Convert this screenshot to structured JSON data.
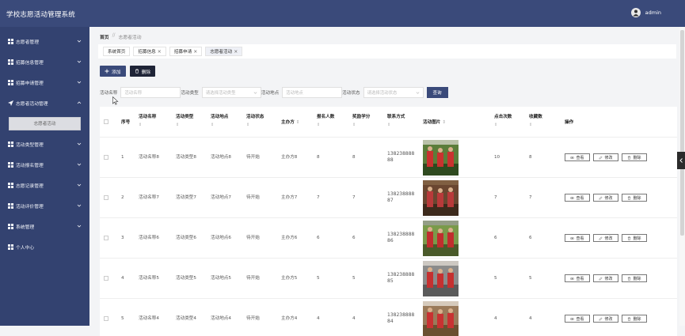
{
  "app": {
    "title": "学校志愿活动管理系统",
    "user": "admin"
  },
  "sidebar": {
    "items": [
      {
        "label": "志愿者管理"
      },
      {
        "label": "招募信息管理"
      },
      {
        "label": "招募申请管理"
      },
      {
        "label": "志愿者活动管理",
        "expanded": true
      },
      {
        "label": "活动类型管理"
      },
      {
        "label": "活动报名管理"
      },
      {
        "label": "志愿记录管理"
      },
      {
        "label": "活动评价管理"
      },
      {
        "label": "系统管理"
      },
      {
        "label": "个人中心"
      }
    ],
    "submenu": {
      "label": "志愿者活动"
    }
  },
  "breadcrumb": {
    "home": "首页",
    "sep": "//",
    "current": "志愿者活动"
  },
  "tabs": [
    {
      "label": "系统首页",
      "close": ""
    },
    {
      "label": "招募信息",
      "close": "×"
    },
    {
      "label": "招募申请",
      "close": "×"
    },
    {
      "label": "志愿者活动",
      "close": "×"
    }
  ],
  "toolbar": {
    "add": "添加",
    "delete": "删除"
  },
  "filters": {
    "name_label": "活动名称",
    "name_ph": "活动名称",
    "type_label": "活动类型",
    "type_ph": "请选择活动类型",
    "place_label": "活动地点",
    "place_ph": "活动地点",
    "status_label": "活动状态",
    "status_ph": "请选择活动状态",
    "query": "查询"
  },
  "table": {
    "headers": [
      "序号",
      "活动名称",
      "活动类型",
      "活动地点",
      "活动状态",
      "主办方",
      "报名人数",
      "奖励学分",
      "联系方式",
      "活动图片",
      "点击次数",
      "收藏数",
      "操作"
    ],
    "sort_glyph": "⇕",
    "actions": {
      "view": "查看",
      "edit": "修改",
      "delete": "删除"
    },
    "rows": [
      {
        "idx": "1",
        "name": "活动名称8",
        "type": "活动类型8",
        "place": "活动地点8",
        "status": "待开始",
        "host": "主办方8",
        "signup": "8",
        "credit": "8",
        "phone1": "138238888",
        "phone2": "88",
        "clicks": "10",
        "favs": "8"
      },
      {
        "idx": "2",
        "name": "活动名称7",
        "type": "活动类型7",
        "place": "活动地点7",
        "status": "待开始",
        "host": "主办方7",
        "signup": "7",
        "credit": "7",
        "phone1": "138238888",
        "phone2": "87",
        "clicks": "7",
        "favs": "7"
      },
      {
        "idx": "3",
        "name": "活动名称6",
        "type": "活动类型6",
        "place": "活动地点6",
        "status": "待开始",
        "host": "主办方6",
        "signup": "6",
        "credit": "6",
        "phone1": "138238888",
        "phone2": "86",
        "clicks": "6",
        "favs": "6"
      },
      {
        "idx": "4",
        "name": "活动名称5",
        "type": "活动类型5",
        "place": "活动地点5",
        "status": "待开始",
        "host": "主办方5",
        "signup": "5",
        "credit": "5",
        "phone1": "138238888",
        "phone2": "85",
        "clicks": "5",
        "favs": "5"
      },
      {
        "idx": "5",
        "name": "活动名称4",
        "type": "活动类型4",
        "place": "活动地点4",
        "status": "待开始",
        "host": "主办方4",
        "signup": "4",
        "credit": "4",
        "phone1": "138238888",
        "phone2": "84",
        "clicks": "4",
        "favs": "4"
      }
    ]
  },
  "colors": {
    "header": "#3a4a7a",
    "sidebar": "#334270",
    "accent": "#3a4a7a",
    "dark_button": "#1f2437"
  }
}
